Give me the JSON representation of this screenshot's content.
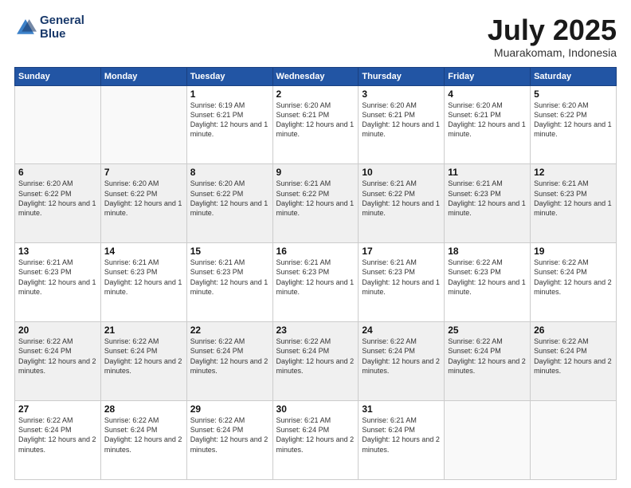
{
  "logo": {
    "line1": "General",
    "line2": "Blue"
  },
  "header": {
    "month": "July 2025",
    "location": "Muarakomam, Indonesia"
  },
  "weekdays": [
    "Sunday",
    "Monday",
    "Tuesday",
    "Wednesday",
    "Thursday",
    "Friday",
    "Saturday"
  ],
  "rows": [
    [
      {
        "day": "",
        "empty": true
      },
      {
        "day": "",
        "empty": true
      },
      {
        "day": "1",
        "info": "Sunrise: 6:19 AM\nSunset: 6:21 PM\nDaylight: 12 hours\nand 1 minute."
      },
      {
        "day": "2",
        "info": "Sunrise: 6:20 AM\nSunset: 6:21 PM\nDaylight: 12 hours\nand 1 minute."
      },
      {
        "day": "3",
        "info": "Sunrise: 6:20 AM\nSunset: 6:21 PM\nDaylight: 12 hours\nand 1 minute."
      },
      {
        "day": "4",
        "info": "Sunrise: 6:20 AM\nSunset: 6:21 PM\nDaylight: 12 hours\nand 1 minute."
      },
      {
        "day": "5",
        "info": "Sunrise: 6:20 AM\nSunset: 6:22 PM\nDaylight: 12 hours\nand 1 minute."
      }
    ],
    [
      {
        "day": "6",
        "info": "Sunrise: 6:20 AM\nSunset: 6:22 PM\nDaylight: 12 hours\nand 1 minute."
      },
      {
        "day": "7",
        "info": "Sunrise: 6:20 AM\nSunset: 6:22 PM\nDaylight: 12 hours\nand 1 minute."
      },
      {
        "day": "8",
        "info": "Sunrise: 6:20 AM\nSunset: 6:22 PM\nDaylight: 12 hours\nand 1 minute."
      },
      {
        "day": "9",
        "info": "Sunrise: 6:21 AM\nSunset: 6:22 PM\nDaylight: 12 hours\nand 1 minute."
      },
      {
        "day": "10",
        "info": "Sunrise: 6:21 AM\nSunset: 6:22 PM\nDaylight: 12 hours\nand 1 minute."
      },
      {
        "day": "11",
        "info": "Sunrise: 6:21 AM\nSunset: 6:23 PM\nDaylight: 12 hours\nand 1 minute."
      },
      {
        "day": "12",
        "info": "Sunrise: 6:21 AM\nSunset: 6:23 PM\nDaylight: 12 hours\nand 1 minute."
      }
    ],
    [
      {
        "day": "13",
        "info": "Sunrise: 6:21 AM\nSunset: 6:23 PM\nDaylight: 12 hours\nand 1 minute."
      },
      {
        "day": "14",
        "info": "Sunrise: 6:21 AM\nSunset: 6:23 PM\nDaylight: 12 hours\nand 1 minute."
      },
      {
        "day": "15",
        "info": "Sunrise: 6:21 AM\nSunset: 6:23 PM\nDaylight: 12 hours\nand 1 minute."
      },
      {
        "day": "16",
        "info": "Sunrise: 6:21 AM\nSunset: 6:23 PM\nDaylight: 12 hours\nand 1 minute."
      },
      {
        "day": "17",
        "info": "Sunrise: 6:21 AM\nSunset: 6:23 PM\nDaylight: 12 hours\nand 1 minute."
      },
      {
        "day": "18",
        "info": "Sunrise: 6:22 AM\nSunset: 6:23 PM\nDaylight: 12 hours\nand 1 minute."
      },
      {
        "day": "19",
        "info": "Sunrise: 6:22 AM\nSunset: 6:24 PM\nDaylight: 12 hours\nand 2 minutes."
      }
    ],
    [
      {
        "day": "20",
        "info": "Sunrise: 6:22 AM\nSunset: 6:24 PM\nDaylight: 12 hours\nand 2 minutes."
      },
      {
        "day": "21",
        "info": "Sunrise: 6:22 AM\nSunset: 6:24 PM\nDaylight: 12 hours\nand 2 minutes."
      },
      {
        "day": "22",
        "info": "Sunrise: 6:22 AM\nSunset: 6:24 PM\nDaylight: 12 hours\nand 2 minutes."
      },
      {
        "day": "23",
        "info": "Sunrise: 6:22 AM\nSunset: 6:24 PM\nDaylight: 12 hours\nand 2 minutes."
      },
      {
        "day": "24",
        "info": "Sunrise: 6:22 AM\nSunset: 6:24 PM\nDaylight: 12 hours\nand 2 minutes."
      },
      {
        "day": "25",
        "info": "Sunrise: 6:22 AM\nSunset: 6:24 PM\nDaylight: 12 hours\nand 2 minutes."
      },
      {
        "day": "26",
        "info": "Sunrise: 6:22 AM\nSunset: 6:24 PM\nDaylight: 12 hours\nand 2 minutes."
      }
    ],
    [
      {
        "day": "27",
        "info": "Sunrise: 6:22 AM\nSunset: 6:24 PM\nDaylight: 12 hours\nand 2 minutes."
      },
      {
        "day": "28",
        "info": "Sunrise: 6:22 AM\nSunset: 6:24 PM\nDaylight: 12 hours\nand 2 minutes."
      },
      {
        "day": "29",
        "info": "Sunrise: 6:22 AM\nSunset: 6:24 PM\nDaylight: 12 hours\nand 2 minutes."
      },
      {
        "day": "30",
        "info": "Sunrise: 6:21 AM\nSunset: 6:24 PM\nDaylight: 12 hours\nand 2 minutes."
      },
      {
        "day": "31",
        "info": "Sunrise: 6:21 AM\nSunset: 6:24 PM\nDaylight: 12 hours\nand 2 minutes."
      },
      {
        "day": "",
        "empty": true
      },
      {
        "day": "",
        "empty": true
      }
    ]
  ]
}
